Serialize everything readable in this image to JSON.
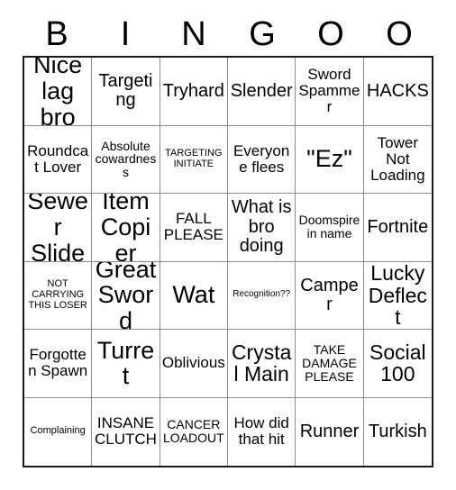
{
  "card": {
    "header_letters": [
      "B",
      "I",
      "N",
      "G",
      "O",
      "O"
    ],
    "columns": 6,
    "rows": 6,
    "colors": {
      "background": "#ffffff",
      "text": "#000000",
      "outer_border": "#1a1a1a",
      "inner_grid_line": "#8c8c8c"
    },
    "cells": [
      {
        "text": "Nice lag bro",
        "size": "xxl"
      },
      {
        "text": "Targeting",
        "size": "lg"
      },
      {
        "text": "Tryhard",
        "size": "lg"
      },
      {
        "text": "Slender",
        "size": "lg"
      },
      {
        "text": "Sword Spammer",
        "size": "md"
      },
      {
        "text": "HACKS",
        "size": "lg"
      },
      {
        "text": "Roundcat Lover",
        "size": "md"
      },
      {
        "text": "Absolute cowardness",
        "size": "sm"
      },
      {
        "text": "TARGETING INITIATE",
        "size": "xs"
      },
      {
        "text": "Everyone flees",
        "size": "md"
      },
      {
        "text": "\"Ez\"",
        "size": "xxl"
      },
      {
        "text": "Tower Not Loading",
        "size": "md"
      },
      {
        "text": "Sewer Slide",
        "size": "xxl"
      },
      {
        "text": "Item Copier",
        "size": "xxl"
      },
      {
        "text": "FALL PLEASE",
        "size": "md"
      },
      {
        "text": "What is bro doing",
        "size": "lg"
      },
      {
        "text": "Doomspire in name",
        "size": "sm"
      },
      {
        "text": "Fortnite",
        "size": "lg"
      },
      {
        "text": "NOT CARRYING THIS LOSER",
        "size": "xs"
      },
      {
        "text": "Great Sword",
        "size": "xxl"
      },
      {
        "text": "Wat",
        "size": "xxl"
      },
      {
        "text": "Recognition??",
        "size": "xxs"
      },
      {
        "text": "Camper",
        "size": "lg"
      },
      {
        "text": "Lucky Deflect",
        "size": "xl"
      },
      {
        "text": "Forgotten Spawn",
        "size": "md"
      },
      {
        "text": "Turret",
        "size": "xxl"
      },
      {
        "text": "Oblivious",
        "size": "md"
      },
      {
        "text": "Crystal Main",
        "size": "xl"
      },
      {
        "text": "TAKE DAMAGE PLEASE",
        "size": "sm"
      },
      {
        "text": "Social 100",
        "size": "xl"
      },
      {
        "text": "Complaining",
        "size": "xs"
      },
      {
        "text": "INSANE CLUTCH",
        "size": "md"
      },
      {
        "text": "CANCER LOADOUT",
        "size": "sm"
      },
      {
        "text": "How did that hit",
        "size": "md"
      },
      {
        "text": "Runner",
        "size": "lg"
      },
      {
        "text": "Turkish",
        "size": "lg"
      }
    ]
  }
}
